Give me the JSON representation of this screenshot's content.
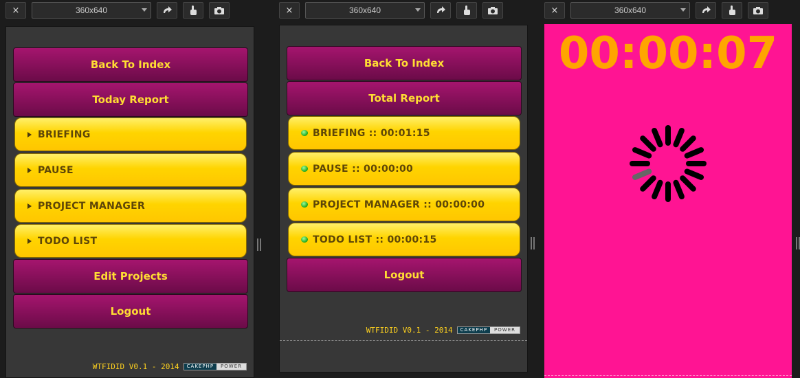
{
  "panels": [
    {
      "viewport": "360x640",
      "buttons": {
        "back": "Back To Index",
        "report": "Today Report",
        "edit": "Edit Projects",
        "logout": "Logout"
      },
      "items": [
        "BRIEFING",
        "PAUSE",
        "PROJECT MANAGER",
        "TODO LIST"
      ],
      "footer": {
        "text": "WTFIDID V0.1 - 2014",
        "badge_left": "CAKEPHP",
        "badge_right": "POWER"
      }
    },
    {
      "viewport": "360x640",
      "buttons": {
        "back": "Back To Index",
        "report": "Total Report",
        "logout": "Logout"
      },
      "items": [
        "BRIEFING :: 00:01:15",
        "PAUSE :: 00:00:00",
        "PROJECT MANAGER :: 00:00:00",
        "TODO LIST :: 00:00:15"
      ],
      "footer": {
        "text": "WTFIDID V0.1 - 2014",
        "badge_left": "CAKEPHP",
        "badge_right": "POWER"
      }
    },
    {
      "viewport": "360x640",
      "timer": "00:00:07"
    }
  ],
  "toolbar": {
    "close_icon": "×",
    "rotate_icon": "rotate-icon",
    "touch_icon": "touch-icon",
    "camera_icon": "camera-icon"
  },
  "colors": {
    "purple": "#8e1060",
    "yellow": "#ffd400",
    "label": "#ffdd33",
    "pink": "#ff1493",
    "timer": "#ffa500"
  }
}
